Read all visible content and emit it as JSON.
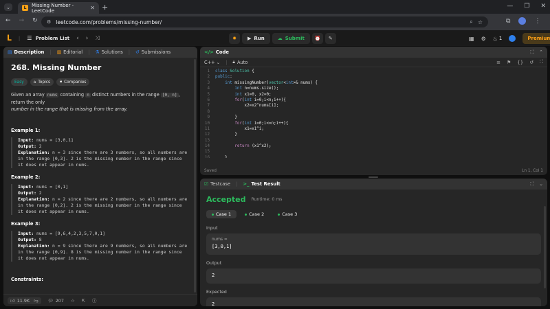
{
  "browser": {
    "tab_title": "Missing Number - LeetCode",
    "url": "leetcode.com/problems/missing-number/"
  },
  "nav": {
    "problem_list": "Problem List",
    "run": "Run",
    "submit": "Submit",
    "streak": "1",
    "premium": "Premium"
  },
  "left": {
    "tabs": [
      "Description",
      "Editorial",
      "Solutions",
      "Submissions"
    ],
    "title": "268. Missing Number",
    "difficulty": "Easy",
    "topics": "Topics",
    "companies": "Companies",
    "desc1": "Given an array ",
    "desc_nums": "nums",
    "desc2": " containing ",
    "desc_n": "n",
    "desc3": " distinct numbers in the range ",
    "desc_range": "[0, n]",
    "desc4": ", return the only",
    "desc5": "number in the range that is missing from the array.",
    "examples": [
      {
        "title": "Example 1:",
        "input": "nums = [3,0,1]",
        "output": "2",
        "explanation": "n = 3 since there are 3 numbers, so all numbers are in the range [0,3]. 2 is the missing number in the range since it does not appear in nums."
      },
      {
        "title": "Example 2:",
        "input": "nums = [0,1]",
        "output": "2",
        "explanation": "n = 2 since there are 2 numbers, so all numbers are in the range [0,2]. 2 is the missing number in the range since it does not appear in nums."
      },
      {
        "title": "Example 3:",
        "input": "nums = [9,6,4,2,3,5,7,0,1]",
        "output": "8",
        "explanation": "n = 9 since there are 9 numbers, so all numbers are in the range [0,9]. 8 is the missing number in the range since it does not appear in nums."
      }
    ],
    "labels": {
      "input": "Input:",
      "output": "Output:",
      "explanation": "Explanation:"
    },
    "constraints": "Constraints:",
    "likes": "11.9K",
    "comments": "207"
  },
  "code": {
    "header": "Code",
    "language": "C++",
    "auto": "Auto",
    "status_saved": "Saved",
    "cursor": "Ln 1, Col 1",
    "lines": [
      "class Solution {",
      "public:",
      "    int missingNumber(vector<int>& nums) {",
      "        int n=nums.size();",
      "        int x1=0, x2=0;",
      "        for(int i=0;i<n;i++){",
      "            x2=x2^nums[i];",
      "",
      "        }",
      "        for(int i=0;i<=n;i++){",
      "            x1=x1^i;",
      "        }",
      "",
      "        return (x1^x2);",
      "",
      "    }"
    ]
  },
  "result": {
    "tab_testcase": "Testcase",
    "tab_result": "Test Result",
    "status": "Accepted",
    "runtime": "Runtime: 0 ms",
    "cases": [
      "Case 1",
      "Case 2",
      "Case 3"
    ],
    "input_label": "Input",
    "var_name": "nums =",
    "var_value": "[3,0,1]",
    "output_label": "Output",
    "output_value": "2",
    "expected_label": "Expected",
    "expected_value": "2"
  },
  "colors": {
    "accent": "#ffa116",
    "green": "#2cbb5d",
    "easy": "#00b8a3"
  }
}
